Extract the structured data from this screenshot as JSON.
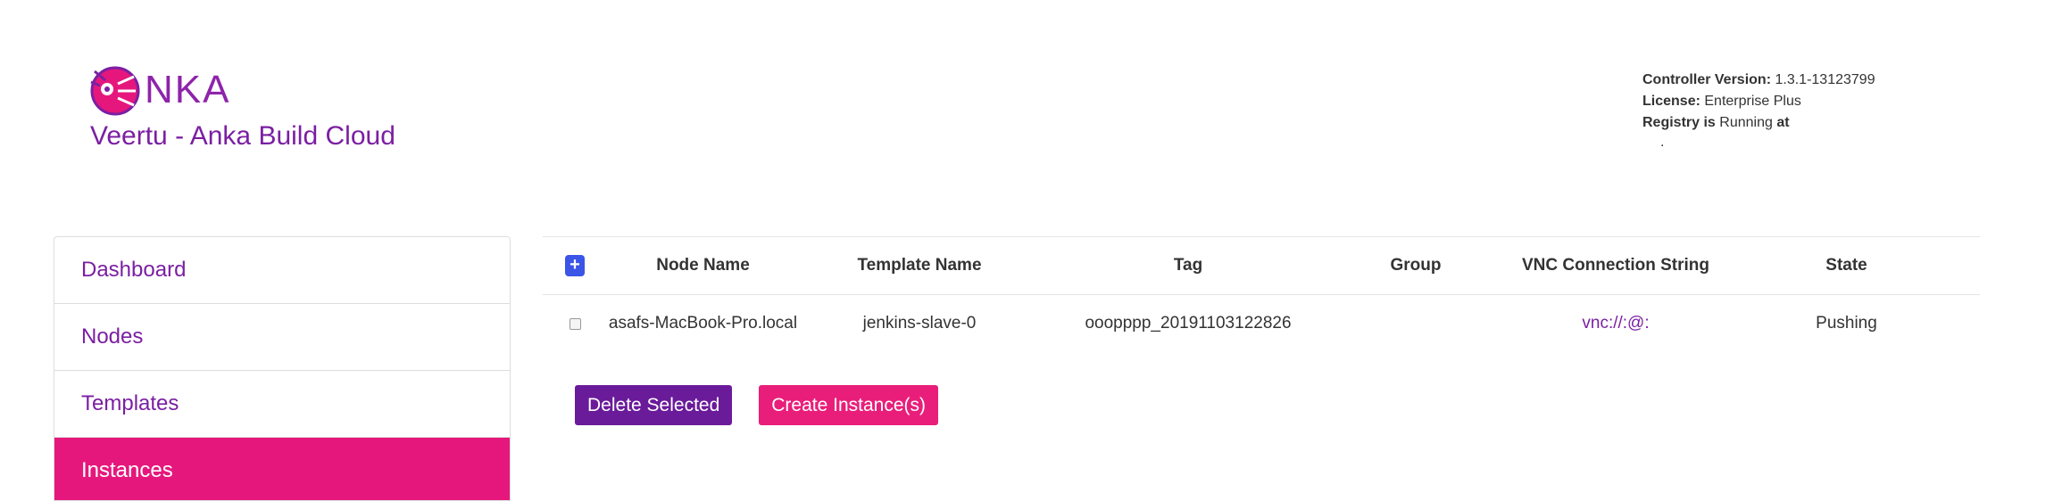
{
  "brand": {
    "logo_text": "NKA",
    "app_title": "Veertu - Anka Build Cloud",
    "brand_color": "#8e24aa",
    "accent_color": "#e6177c"
  },
  "info": {
    "controller_label": "Controller Version:",
    "controller_value": "1.3.1-13123799",
    "license_label": "License:",
    "license_value": "Enterprise Plus",
    "registry_label_1": "Registry is",
    "registry_status": "Running",
    "registry_label_2": "at",
    "registry_address": "."
  },
  "sidebar": {
    "items": [
      {
        "label": "Dashboard"
      },
      {
        "label": "Nodes"
      },
      {
        "label": "Templates"
      },
      {
        "label": "Instances"
      }
    ],
    "active_index": 3
  },
  "table": {
    "add_icon": "plus-icon",
    "headers": {
      "node": "Node Name",
      "template": "Template Name",
      "tag": "Tag",
      "group": "Group",
      "vnc": "VNC Connection String",
      "state": "State"
    },
    "rows": [
      {
        "node": "asafs-MacBook-Pro.local",
        "template": "jenkins-slave-0",
        "tag": "ooopppp_20191103122826",
        "group": "",
        "vnc": "vnc://:@:",
        "state": "Pushing"
      }
    ]
  },
  "actions": {
    "delete_label": "Delete Selected",
    "create_label": "Create Instance(s)"
  }
}
